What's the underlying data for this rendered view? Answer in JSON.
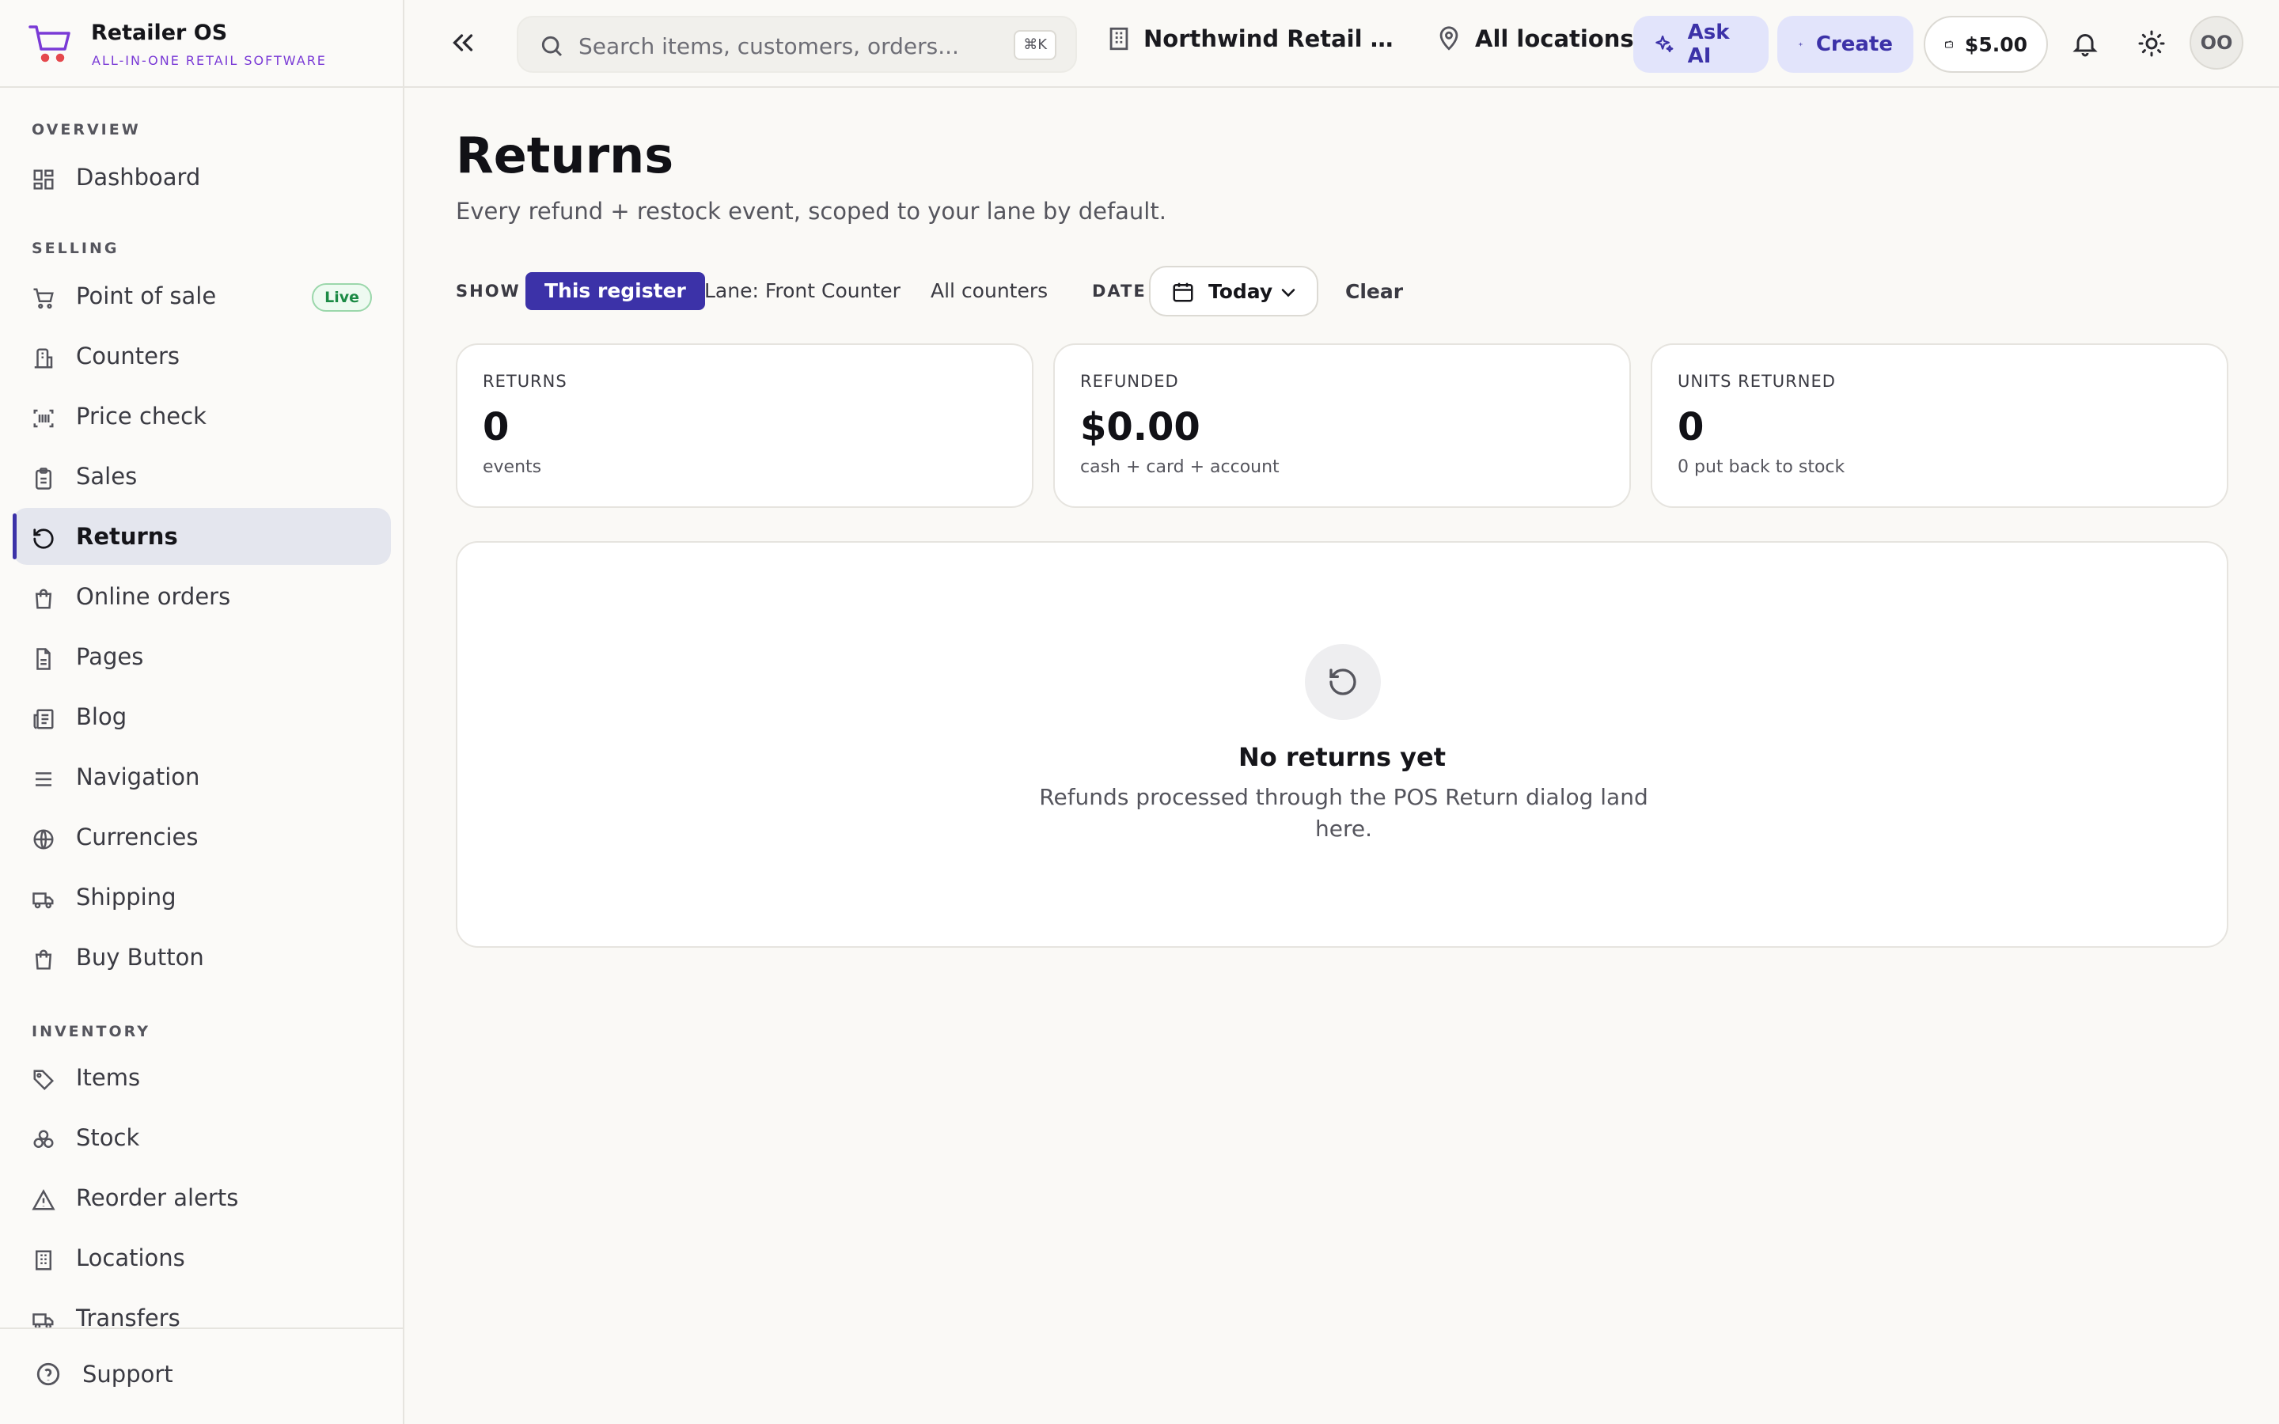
{
  "brand": {
    "name": "Retailer OS",
    "tagline": "ALL-IN-ONE RETAIL SOFTWARE"
  },
  "sidebar": {
    "sections": [
      {
        "label": "OVERVIEW",
        "items": [
          {
            "label": "Dashboard",
            "icon": "dashboard-icon"
          }
        ]
      },
      {
        "label": "SELLING",
        "items": [
          {
            "label": "Point of sale",
            "icon": "cart-icon",
            "badge": "Live"
          },
          {
            "label": "Counters",
            "icon": "counter-icon"
          },
          {
            "label": "Price check",
            "icon": "barcode-icon"
          },
          {
            "label": "Sales",
            "icon": "clipboard-icon"
          },
          {
            "label": "Returns",
            "icon": "rotate-ccw-icon",
            "active": true
          },
          {
            "label": "Online orders",
            "icon": "shopping-bag-icon"
          },
          {
            "label": "Pages",
            "icon": "file-icon"
          },
          {
            "label": "Blog",
            "icon": "newspaper-icon"
          },
          {
            "label": "Navigation",
            "icon": "menu-icon"
          },
          {
            "label": "Currencies",
            "icon": "globe-icon"
          },
          {
            "label": "Shipping",
            "icon": "truck-icon"
          },
          {
            "label": "Buy Button",
            "icon": "shopping-bag-icon"
          }
        ]
      },
      {
        "label": "INVENTORY",
        "items": [
          {
            "label": "Items",
            "icon": "tag-icon"
          },
          {
            "label": "Stock",
            "icon": "boxes-icon"
          },
          {
            "label": "Reorder alerts",
            "icon": "alert-triangle-icon"
          },
          {
            "label": "Locations",
            "icon": "building-icon"
          },
          {
            "label": "Transfers",
            "icon": "truck-icon"
          }
        ]
      }
    ],
    "footer": {
      "support_label": "Support"
    }
  },
  "topbar": {
    "search_placeholder": "Search items, customers, orders...",
    "search_shortcut": "⌘K",
    "store": "Northwind Retail (Demo)",
    "locations": "All locations",
    "ask_ai": "Ask AI",
    "create": "Create",
    "wallet": "$5.00",
    "avatar_initials": "OO"
  },
  "page": {
    "title": "Returns",
    "subtitle": "Every refund + restock event, scoped to your lane by default.",
    "filters": {
      "show_label": "SHOW",
      "options": [
        "This register",
        "Lane: Front Counter",
        "All counters"
      ],
      "selected": "This register",
      "date_label": "DATE",
      "date_value": "Today",
      "clear": "Clear"
    },
    "stats": [
      {
        "key": "RETURNS",
        "value": "0",
        "sub": "events"
      },
      {
        "key": "REFUNDED",
        "value": "$0.00",
        "sub": "cash + card + account"
      },
      {
        "key": "UNITS RETURNED",
        "value": "0",
        "sub": "0 put back to stock"
      }
    ],
    "empty": {
      "title": "No returns yet",
      "description": "Refunds processed through the POS Return dialog land here."
    }
  },
  "colors": {
    "accent": "#3c32a8",
    "brand_purple": "#7a3ad6",
    "live_green": "#1c8a45",
    "logo_red": "#e5484d"
  }
}
